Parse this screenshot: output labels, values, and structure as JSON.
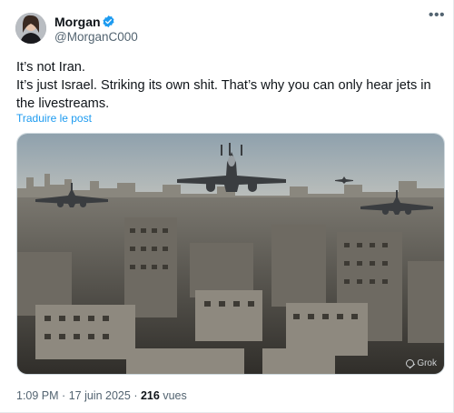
{
  "author": {
    "name": "Morgan",
    "handle": "@MorganC000",
    "verified_color": "#1d9bf0"
  },
  "more_icon": "more-horizontal-icon",
  "tweet": {
    "line1": "It’s not Iran.",
    "line2": "It’s just Israel. Striking its own shit. That’s why you can only hear jets in the livestreams.",
    "translate_label": "Traduire le post"
  },
  "media": {
    "watermark": "Grok",
    "watermark_icon": "grok-icon"
  },
  "meta": {
    "time": "1:09 PM",
    "date": "17 juin 2025",
    "separator": "·",
    "views": "216",
    "views_label": "vues"
  },
  "colors": {
    "link": "#1d9bf0",
    "secondary_text": "#536471",
    "primary_text": "#0f1419"
  }
}
